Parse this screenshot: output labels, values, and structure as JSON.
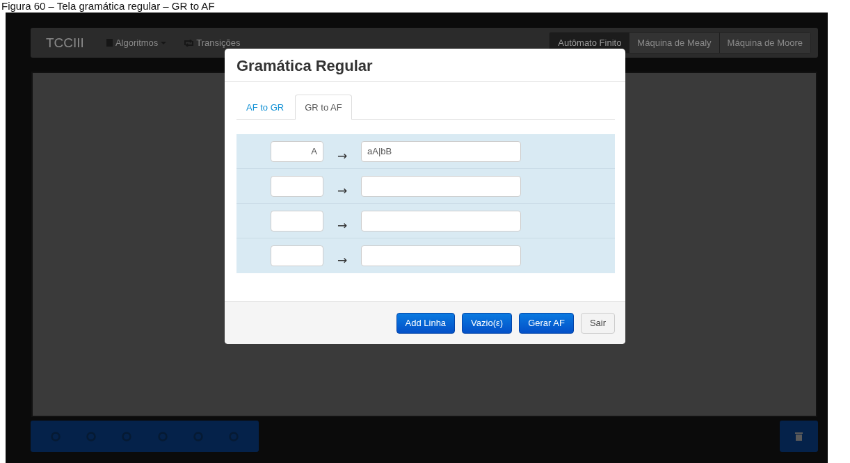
{
  "caption": "Figura 60 – Tela gramática regular – GR to AF",
  "navbar": {
    "brand": "TCCIII",
    "menus": [
      {
        "label": "Algoritmos",
        "kind": "dropdown"
      },
      {
        "label": "Transições",
        "kind": "link"
      }
    ],
    "modes": [
      {
        "label": "Autômato Finito",
        "selected": true
      },
      {
        "label": "Máquina de Mealy",
        "selected": false
      },
      {
        "label": "Máquina de Moore",
        "selected": false
      }
    ]
  },
  "modal": {
    "title": "Gramática Regular",
    "tabs": [
      {
        "label": "AF to GR",
        "selected": false
      },
      {
        "label": "GR to AF",
        "selected": true
      }
    ],
    "rules": [
      {
        "left": "A",
        "arrow": "→",
        "right": "aA|bB"
      },
      {
        "arrow": "→"
      },
      {
        "arrow": "→"
      },
      {
        "arrow": "→"
      }
    ],
    "buttons": [
      {
        "label": "Add Linha",
        "kind": "primary"
      },
      {
        "label": "Vazio(ε)",
        "kind": "primary"
      },
      {
        "label": "Gerar AF",
        "kind": "primary"
      },
      {
        "label": "Sair",
        "kind": "default"
      }
    ]
  }
}
